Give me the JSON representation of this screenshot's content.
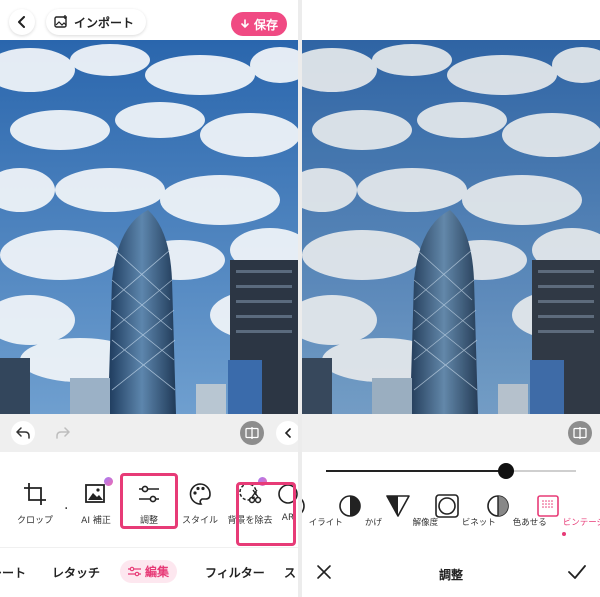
{
  "left": {
    "import_label": "インポート",
    "save_label": "保存",
    "tools": [
      {
        "label": "クロップ",
        "icon": "crop-icon"
      },
      {
        "label": "AI 補正",
        "icon": "ai-enhance-icon"
      },
      {
        "label": "調整",
        "icon": "adjust-sliders-icon"
      },
      {
        "label": "スタイル",
        "icon": "palette-icon"
      },
      {
        "label": "背景を除去",
        "icon": "remove-background-icon"
      },
      {
        "label": "AR",
        "icon": "ar-icon"
      }
    ],
    "tabs": [
      "レート",
      "レタッチ",
      "編集",
      "フィルター",
      "ス"
    ]
  },
  "right": {
    "tools": [
      {
        "label": "イライト",
        "icon": "highlight-icon"
      },
      {
        "label": "かげ",
        "icon": "shadow-icon"
      },
      {
        "label": "解像度",
        "icon": "sharpness-icon"
      },
      {
        "label": "ビネット",
        "icon": "vignette-icon"
      },
      {
        "label": "色あせる",
        "icon": "fade-icon"
      },
      {
        "label": "ビンテージ",
        "icon": "vintage-icon"
      }
    ],
    "title": "調整",
    "slider_value": 0.72
  },
  "colors": {
    "accent": "#e73b77",
    "save": "#f04a83",
    "sky": "#2f6fb5"
  }
}
